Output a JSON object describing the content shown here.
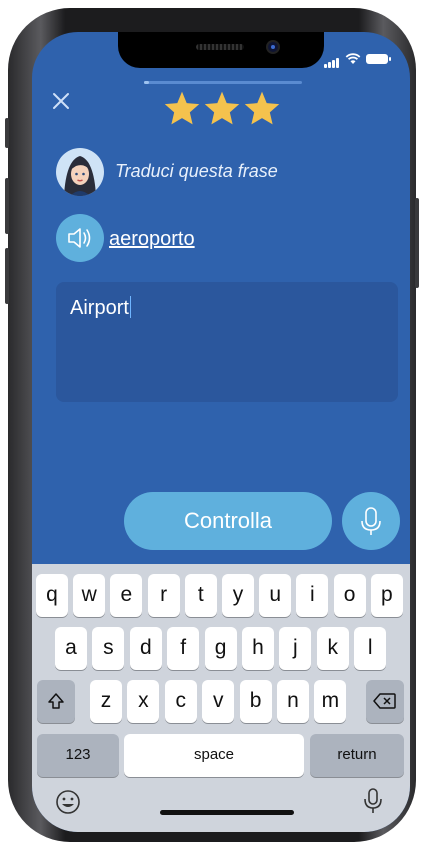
{
  "lesson": {
    "progress_fraction": 0.03,
    "stars": 3,
    "star_color": "#f4c24d"
  },
  "prompt": {
    "instruction": "Traduci questa frase",
    "word": "aeroporto"
  },
  "answer": {
    "value": "Airport"
  },
  "actions": {
    "check_label": "Controlla"
  },
  "keyboard": {
    "row1": [
      "q",
      "w",
      "e",
      "r",
      "t",
      "y",
      "u",
      "i",
      "o",
      "p"
    ],
    "row2": [
      "a",
      "s",
      "d",
      "f",
      "g",
      "h",
      "j",
      "k",
      "l"
    ],
    "row3": [
      "z",
      "x",
      "c",
      "v",
      "b",
      "n",
      "m"
    ],
    "numbers_label": "123",
    "space_label": "space",
    "return_label": "return"
  },
  "colors": {
    "background": "#2f62ad",
    "accent": "#5fb0dd",
    "answer_box": "#2b579d"
  },
  "icons": [
    "close-icon",
    "star-icon",
    "speaker-icon",
    "microphone-icon",
    "shift-icon",
    "backspace-icon",
    "emoji-icon",
    "dictation-icon",
    "signal-icon",
    "wifi-icon",
    "battery-icon"
  ]
}
